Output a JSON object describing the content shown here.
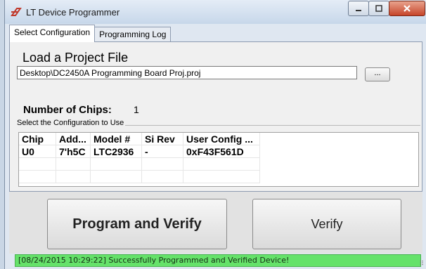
{
  "window": {
    "title": "LT Device Programmer",
    "minimize_icon": "minimize-icon",
    "maximize_icon": "maximize-icon",
    "close_icon": "close-icon"
  },
  "tabs": [
    {
      "label": "Select Configuration",
      "active": true
    },
    {
      "label": "Programming Log",
      "active": false
    }
  ],
  "project": {
    "heading": "Load a Project File",
    "path_value": "Desktop\\DC2450A Programming Board Proj.proj",
    "browse_label": "..."
  },
  "chips": {
    "label": "Number of Chips:",
    "value": "1"
  },
  "configuration": {
    "group_label": "Select the Configuration to Use",
    "columns": [
      "Chip",
      "Add...",
      "Model #",
      "Si Rev",
      "User Config ..."
    ],
    "rows": [
      [
        "U0",
        "7'h5C",
        "LTC2936",
        "-",
        "0xF43F561D"
      ]
    ]
  },
  "actions": {
    "program_verify_label": "Program and Verify",
    "verify_label": "Verify"
  },
  "status": {
    "message": "[08/24/2015 10:29:22] Successfully Programmed and Verified Device!",
    "color": "#65e26a"
  }
}
